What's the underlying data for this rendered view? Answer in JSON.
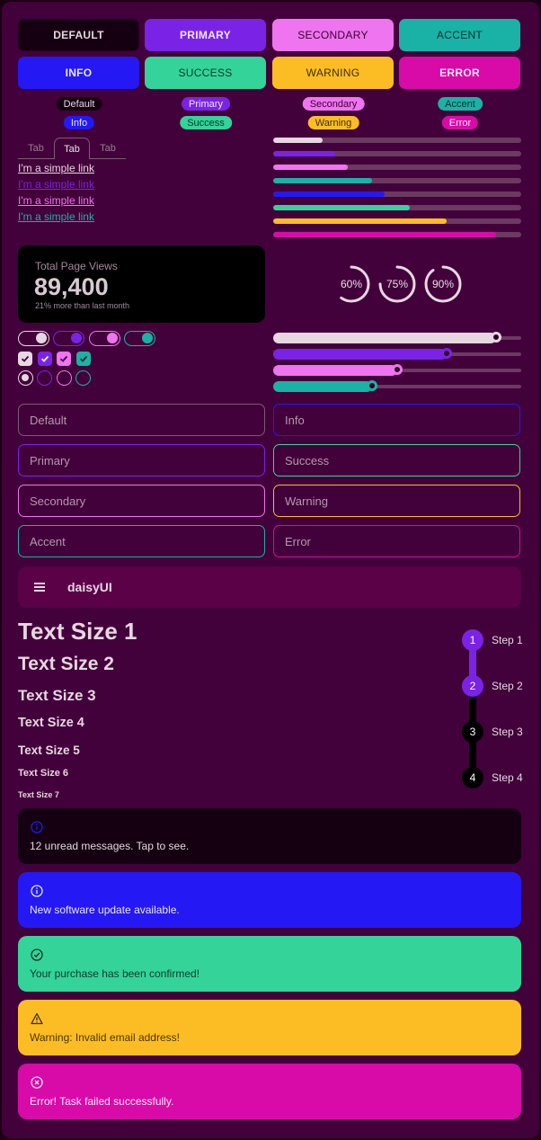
{
  "colors": {
    "default": "#140010",
    "primary": "#7a23e6",
    "secondary": "#ef74ef",
    "accent": "#1ab2a6",
    "info": "#2418f5",
    "success": "#34d399",
    "warning": "#fbbd23",
    "error": "#d80aa8",
    "neutral_light": "#e6d7e0"
  },
  "buttons": [
    "DEFAULT",
    "PRIMARY",
    "SECONDARY",
    "ACCENT",
    "INFO",
    "SUCCESS",
    "WARNING",
    "ERROR"
  ],
  "badges": [
    "Default",
    "Primary",
    "Secondary",
    "Accent",
    "Info",
    "Success",
    "Warning",
    "Error"
  ],
  "tabs": [
    "Tab",
    "Tab",
    "Tab"
  ],
  "links": [
    "I'm a simple link",
    "I'm a simple link",
    "I'm a simple link",
    "I'm a simple link"
  ],
  "progress_values": [
    0.2,
    0.25,
    0.3,
    0.4,
    0.45,
    0.55,
    0.7,
    0.9
  ],
  "stat": {
    "title": "Total Page Views",
    "value": "89,400",
    "desc": "21% more than last month"
  },
  "radials": [
    {
      "label": "60%",
      "value": 60
    },
    {
      "label": "75%",
      "value": 75
    },
    {
      "label": "90%",
      "value": 90
    }
  ],
  "ranges": [
    0.9,
    0.7,
    0.5,
    0.4
  ],
  "inputs": {
    "default": "Default",
    "info": "Info",
    "primary": "Primary",
    "success": "Success",
    "secondary": "Secondary",
    "warning": "Warning",
    "accent": "Accent",
    "error": "Error"
  },
  "navbar": {
    "menu_icon": "hamburger-icon",
    "title": "daisyUI"
  },
  "text_sizes": [
    "Text Size 1",
    "Text Size 2",
    "Text Size 3",
    "Text Size 4",
    "Text Size 5",
    "Text Size 6",
    "Text Size 7"
  ],
  "steps": [
    {
      "num": "1",
      "label": "Step 1",
      "done": true
    },
    {
      "num": "2",
      "label": "Step 2",
      "done": true
    },
    {
      "num": "3",
      "label": "Step 3",
      "done": false
    },
    {
      "num": "4",
      "label": "Step 4",
      "done": false
    }
  ],
  "alerts": [
    {
      "icon": "info-icon",
      "text": "12 unread messages. Tap to see."
    },
    {
      "icon": "info-icon",
      "text": "New software update available."
    },
    {
      "icon": "check-circle-icon",
      "text": "Your purchase has been confirmed!"
    },
    {
      "icon": "warning-icon",
      "text": "Warning: Invalid email address!"
    },
    {
      "icon": "x-circle-icon",
      "text": "Error! Task failed successfully."
    }
  ]
}
